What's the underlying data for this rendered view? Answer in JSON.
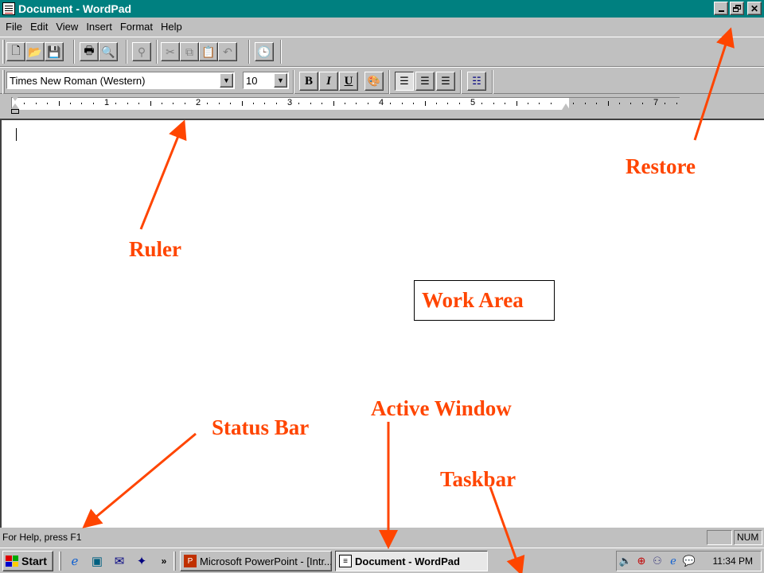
{
  "window": {
    "title": "Document - WordPad",
    "controls": [
      "minimize",
      "restore",
      "close"
    ]
  },
  "menu": [
    "File",
    "Edit",
    "View",
    "Insert",
    "Format",
    "Help"
  ],
  "toolbar": {
    "buttons": [
      "new-icon",
      "open-icon",
      "save-icon",
      "print-icon",
      "print-preview-icon",
      "find-icon",
      "cut-icon",
      "copy-icon",
      "paste-icon",
      "undo-icon",
      "date-time-icon"
    ]
  },
  "format_bar": {
    "font": "Times New Roman (Western)",
    "size": "10",
    "bold": "B",
    "italic": "I",
    "underline": "U",
    "buttons": [
      "color-icon",
      "align-left-icon",
      "align-center-icon",
      "align-right-icon",
      "bullets-icon"
    ]
  },
  "ruler": {
    "numbers": [
      "1",
      "2",
      "3",
      "4",
      "5",
      "7"
    ]
  },
  "status_bar": {
    "text": "For Help, press F1",
    "num": "NUM"
  },
  "taskbar": {
    "start": "Start",
    "quick_launch": [
      "internet-explorer-icon",
      "desktop-icon",
      "outlook-icon",
      "channels-icon"
    ],
    "more": "»",
    "tasks": [
      {
        "label": "Microsoft PowerPoint - [Intr...",
        "active": false
      },
      {
        "label": "Document - WordPad",
        "active": true
      }
    ],
    "tray_icons": [
      "volume-icon",
      "antivirus-icon",
      "network-icon",
      "ie-tray-icon",
      "message-icon"
    ],
    "clock": "11:34 PM"
  },
  "annotations": {
    "restore": "Restore",
    "ruler": "Ruler",
    "work_area": "Work Area",
    "active_window": "Active Window",
    "status_bar": "Status Bar",
    "taskbar": "Taskbar"
  },
  "colors": {
    "title_bar": "#008080",
    "annotation": "#ff4500",
    "face": "#c0c0c0"
  }
}
